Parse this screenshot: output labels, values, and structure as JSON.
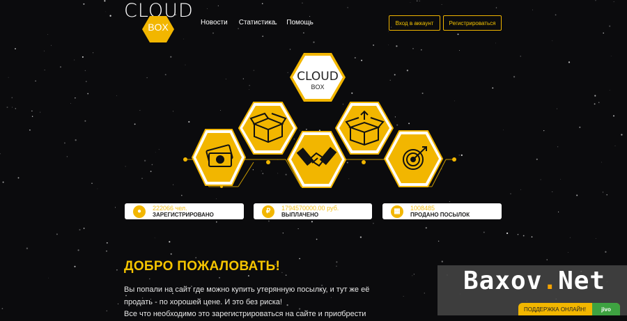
{
  "header": {
    "logo_word": "CLOUD",
    "logo_box": "BOX",
    "nav": [
      "Новости",
      "Статистика",
      "Помощь"
    ],
    "login_label": "Вход в аккаунт",
    "register_label": "Регистрироваться"
  },
  "hero": {
    "logo_word": "CLOUD",
    "logo_box": "BOX",
    "hexagons": [
      "money-icon",
      "box-icon",
      "handshake-icon",
      "open-box-icon",
      "target-icon"
    ]
  },
  "stats": [
    {
      "value": "222066 чел.",
      "label": "ЗАРЕГИСТРИРОВАНО",
      "icon": "user-icon"
    },
    {
      "value": "1794570000.00 руб.",
      "label": "ВЫПЛАЧЕНО",
      "icon": "ruble-icon"
    },
    {
      "value": "1008485",
      "label": "ПРОДАНО ПОСЫЛОК",
      "icon": "calendar-icon"
    }
  ],
  "welcome": {
    "title": "ДОБРО ПОЖАЛОВАТЬ!",
    "lines": [
      "Вы попали на сайт где можно купить утерянную посылку, и тут же её",
      "продать - по хорошей цене. И это без риска!",
      "Все что необходимо это зарегистрироваться на сайте и приобрести"
    ]
  },
  "watermark": {
    "text": "Baxov",
    "dot": ".",
    "suffix": "Net"
  },
  "support": {
    "label": "ПОДДЕРЖКА ОНЛАЙН!",
    "brand": "jivo"
  },
  "colors": {
    "accent": "#f2b600",
    "background": "#0b0b0d"
  }
}
